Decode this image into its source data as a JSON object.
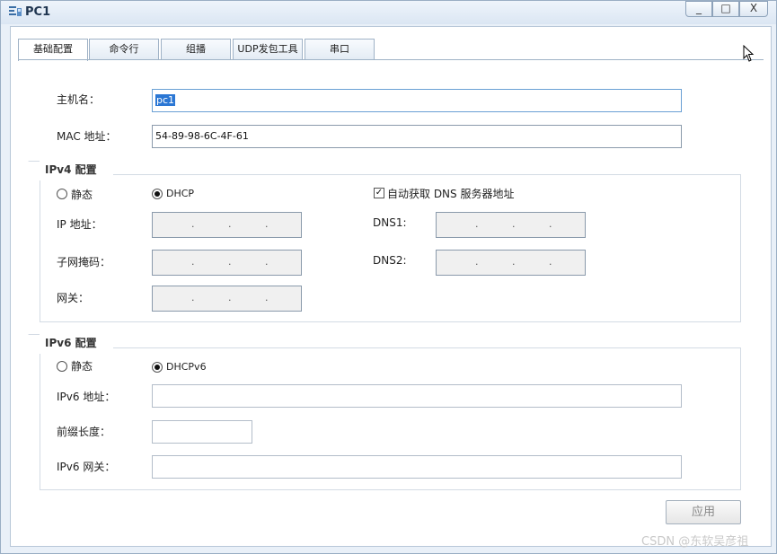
{
  "window": {
    "title": "PC1",
    "min_label": "_",
    "max_label": "□",
    "close_label": "X"
  },
  "tabs": [
    {
      "label": "基础配置",
      "active": true
    },
    {
      "label": "命令行"
    },
    {
      "label": "组播"
    },
    {
      "label": "UDP发包工具"
    },
    {
      "label": "串口"
    }
  ],
  "basic": {
    "hostname_label": "主机名：",
    "hostname_value": "pc1",
    "mac_label": "MAC 地址：",
    "mac_value": "54-89-98-6C-4F-61"
  },
  "ipv4": {
    "legend": "IPv4 配置",
    "static_label": "静态",
    "dhcp_label": "DHCP",
    "dhcp_selected": true,
    "auto_dns_label": "自动获取 DNS 服务器地址",
    "auto_dns_checked": true,
    "ip_label": "IP 地址：",
    "mask_label": "子网掩码：",
    "gateway_label": "网关：",
    "dns1_label": "DNS1:",
    "dns2_label": "DNS2:",
    "ip_dot": "."
  },
  "ipv6": {
    "legend": "IPv6 配置",
    "static_label": "静态",
    "dhcp_label": "DHCPv6",
    "dhcp_selected": true,
    "ip_label": "IPv6 地址：",
    "prefix_label": "前缀长度：",
    "gateway_label": "IPv6 网关："
  },
  "apply_label": "应用",
  "watermark": "CSDN @东软吴彦祖"
}
